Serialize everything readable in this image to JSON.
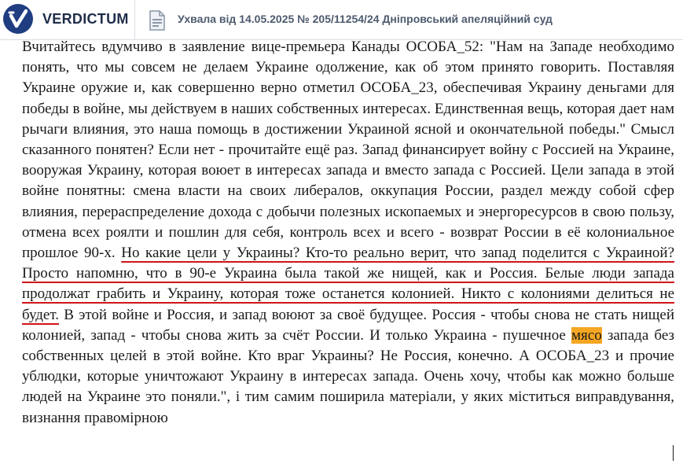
{
  "header": {
    "brand": "VERDICTUM",
    "doc_title": "Ухвала від 14.05.2025 № 205/11254/24 Дніпровський апеляційний суд"
  },
  "colors": {
    "logo_bg": "#1f3d80",
    "underline": "#d0141b",
    "highlight": "#f5a623"
  },
  "body": {
    "before": "Вчитайтесь вдумчиво в заявление вице-премьера Канады ОСОБА_52: \"Нам на Западе необходимо понять, что мы совсем не делаем Украине одолжение, как об этом принято говорить. Поставляя Украине оружие и, как совершенно верно отметил ОСОБА_23, обеспечивая Украину деньгами для победы в войне, мы действуем в наших собственных интересах. Единственная вещь, которая дает нам рычаги влияния, это наша помощь в достижении Украиной ясной и окончательной победы.\" Смысл сказанного понятен? Если нет - прочитайте ещё раз. Запад финансирует войну с Россией на Украине, вооружая Украину, которая воюет в интересах запада и вместо запада с Россией. Цели запада в этой войне понятны: смена власти на своих либералов, оккупация России, раздел между собой сфер влияния, перераспределение дохода с добычи полезных ископаемых и энергоресурсов в свою пользу, отмена всех роялти и пошлин для себя, контроль всех и всего - возврат России в её колониальное прошлое 90-х. ",
    "underlined": "Но какие цели у Украины? Кто-то реально верит, что запад поделится с Украиной? Просто напомню, что в 90-е Украина была такой же нищей, как и Россия. Белые люди запада продолжат грабить и Украину, которая тоже останется колонией. Никто с колониями делиться не будет.",
    "middle": " В этой войне и Россия, и запад воюют за своё будущее. Россия - чтобы снова не стать нищей колонией, запад - чтобы снова жить за счёт России. И только Украина - пушечное ",
    "highlighted": "мясо",
    "after": " запада без собственных целей в этой войне. Кто враг Украины? Не Россия, конечно. А ОСОБА_23 и прочие ублюдки, которые уничтожают Украину в интересах запада. Очень хочу, чтобы как можно больше людей на Украине это поняли.\", і тим самим поширила матеріали, у яких міститься виправдування, визнання правомірною"
  }
}
